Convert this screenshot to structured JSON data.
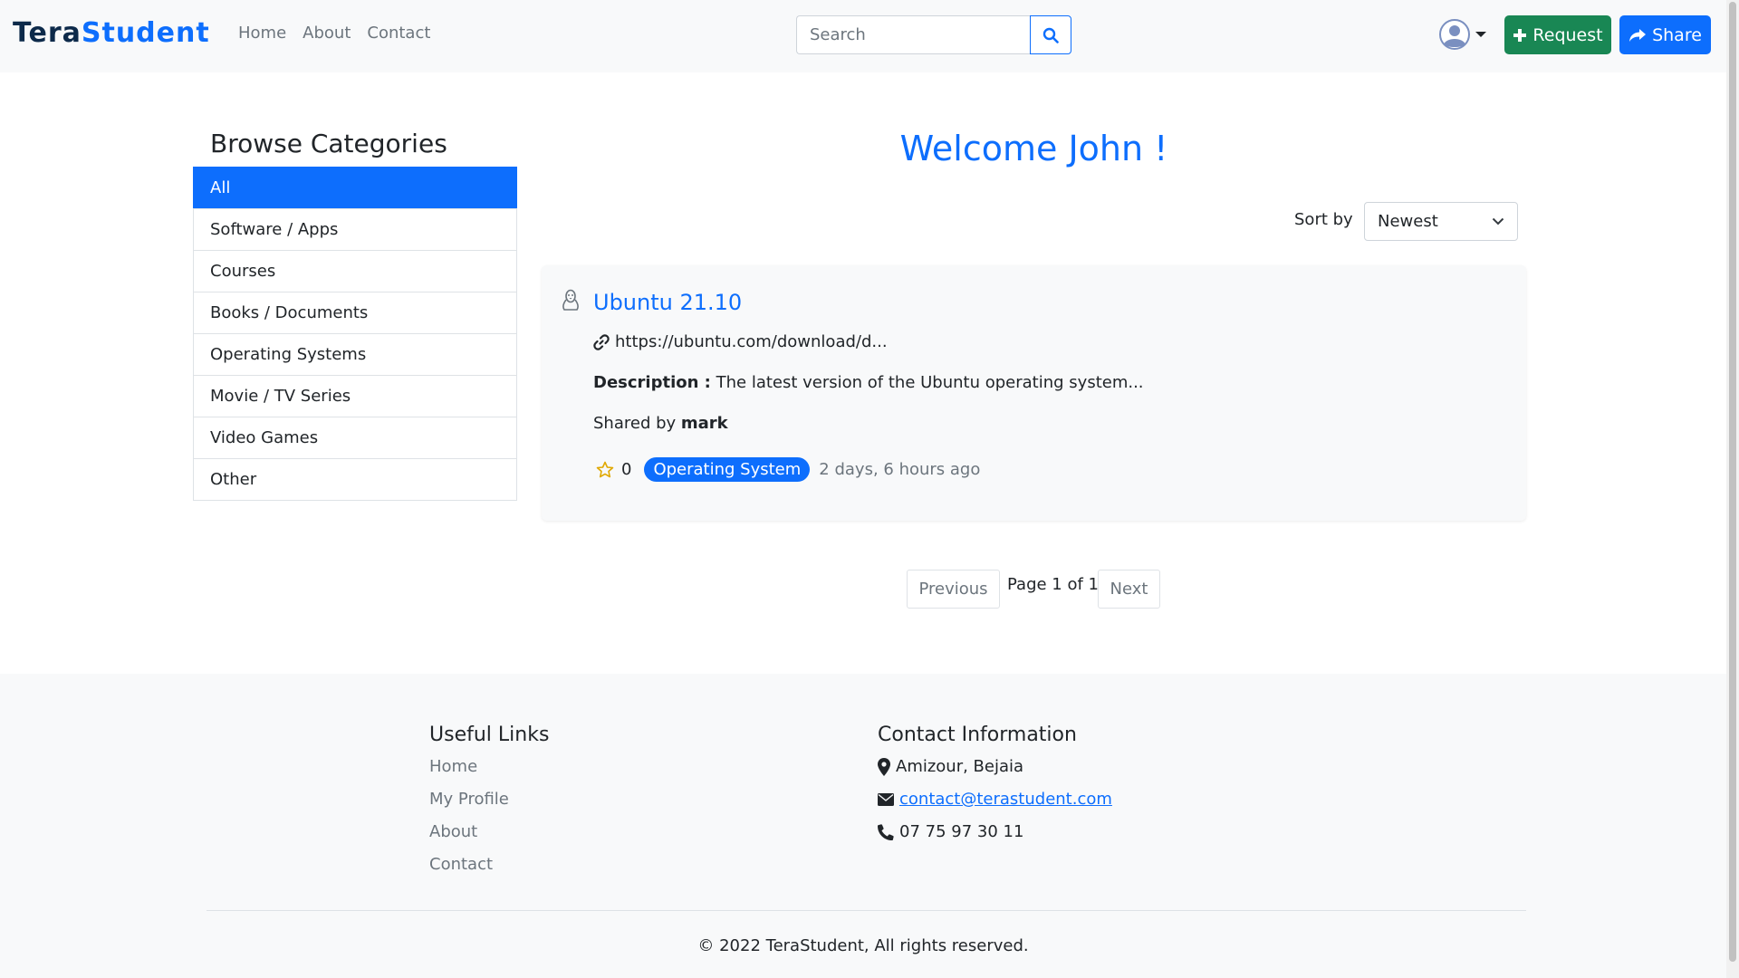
{
  "navbar": {
    "brand_part1": "Tera",
    "brand_part2": "Student",
    "links": [
      "Home",
      "About",
      "Contact"
    ],
    "search_placeholder": "Search",
    "request_label": "Request",
    "share_label": "Share",
    "icons": {
      "search": "search-icon",
      "avatar": "user-avatar-icon",
      "request": "plus-icon",
      "share": "share-icon"
    },
    "colors": {
      "primary": "#0d6efd",
      "success": "#198754"
    }
  },
  "sidebar": {
    "title": "Browse Categories",
    "items": [
      {
        "label": "All",
        "active": true
      },
      {
        "label": "Software / Apps",
        "active": false
      },
      {
        "label": "Courses",
        "active": false
      },
      {
        "label": "Books / Documents",
        "active": false
      },
      {
        "label": "Operating Systems",
        "active": false
      },
      {
        "label": "Movie / TV Series",
        "active": false
      },
      {
        "label": "Video Games",
        "active": false
      },
      {
        "label": "Other",
        "active": false
      }
    ]
  },
  "main": {
    "welcome": "Welcome John !",
    "sort_label": "Sort by",
    "sort_value": "Newest",
    "posts": [
      {
        "icon": "linux-icon",
        "title": "Ubuntu 21.10",
        "url": "https://ubuntu.com/download/d...",
        "description_label": "Description :",
        "description": "The latest version of the Ubuntu operating system...",
        "shared_by_label": "Shared by",
        "shared_by": "mark",
        "stars": "0",
        "category": "Operating System",
        "time": "2 days, 6 hours ago"
      }
    ],
    "pagination": {
      "previous": "Previous",
      "page_text": "Page 1 of 1",
      "next": "Next"
    }
  },
  "footer": {
    "links_title": "Useful Links",
    "links": [
      "Home",
      "My Profile",
      "About",
      "Contact"
    ],
    "contact_title": "Contact Information",
    "address": "Amizour, Bejaia",
    "email": "contact@terastudent.com",
    "phone": "07 75 97 30 11",
    "copyright": "© 2022 TeraStudent, All rights reserved."
  }
}
